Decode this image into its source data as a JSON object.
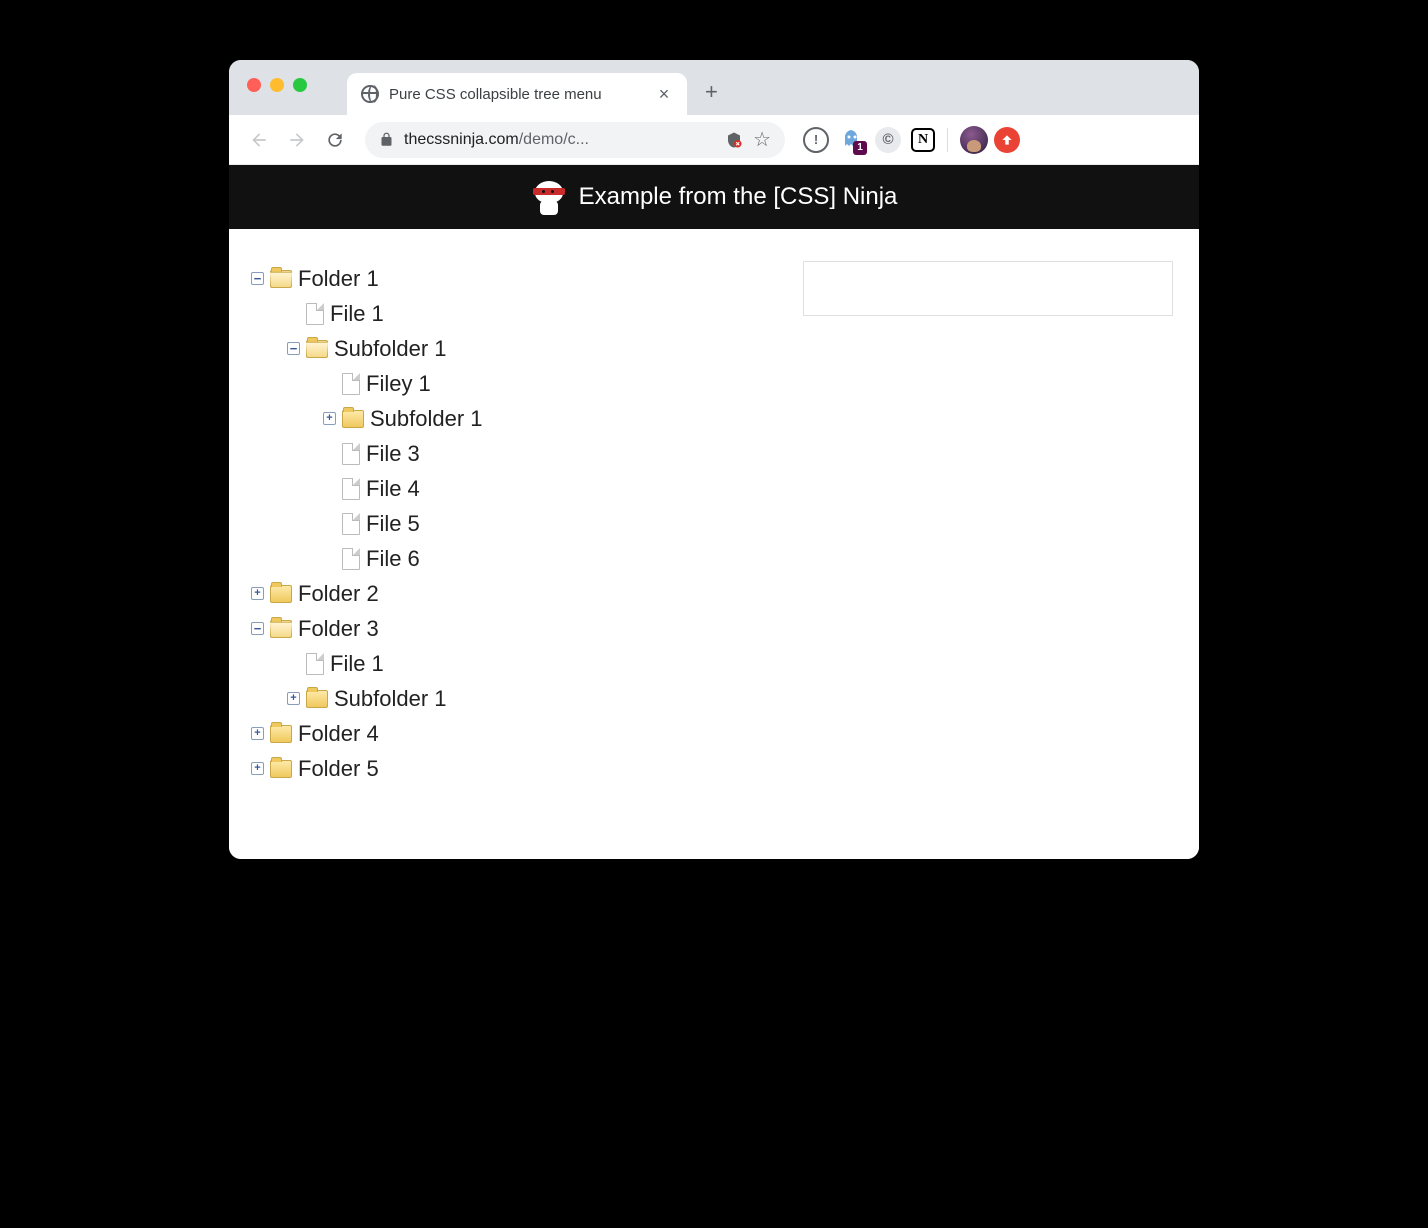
{
  "browser": {
    "tab_title": "Pure CSS collapsible tree menu",
    "url_domain": "thecssninja.com",
    "url_path": "/demo/c...",
    "ghost_badge": "1"
  },
  "page": {
    "header": "Example from the [CSS] Ninja"
  },
  "tree": [
    {
      "label": "Folder 1",
      "type": "folder",
      "expanded": true,
      "children": [
        {
          "label": "File 1",
          "type": "file"
        },
        {
          "label": "Subfolder 1",
          "type": "folder",
          "expanded": true,
          "children": [
            {
              "label": "Filey 1",
              "type": "file"
            },
            {
              "label": "Subfolder 1",
              "type": "folder",
              "expanded": false
            },
            {
              "label": "File 3",
              "type": "file"
            },
            {
              "label": "File 4",
              "type": "file"
            },
            {
              "label": "File 5",
              "type": "file"
            },
            {
              "label": "File 6",
              "type": "file"
            }
          ]
        }
      ]
    },
    {
      "label": "Folder 2",
      "type": "folder",
      "expanded": false
    },
    {
      "label": "Folder 3",
      "type": "folder",
      "expanded": true,
      "children": [
        {
          "label": "File 1",
          "type": "file"
        },
        {
          "label": "Subfolder 1",
          "type": "folder",
          "expanded": false
        }
      ]
    },
    {
      "label": "Folder 4",
      "type": "folder",
      "expanded": false
    },
    {
      "label": "Folder 5",
      "type": "folder",
      "expanded": false
    }
  ]
}
